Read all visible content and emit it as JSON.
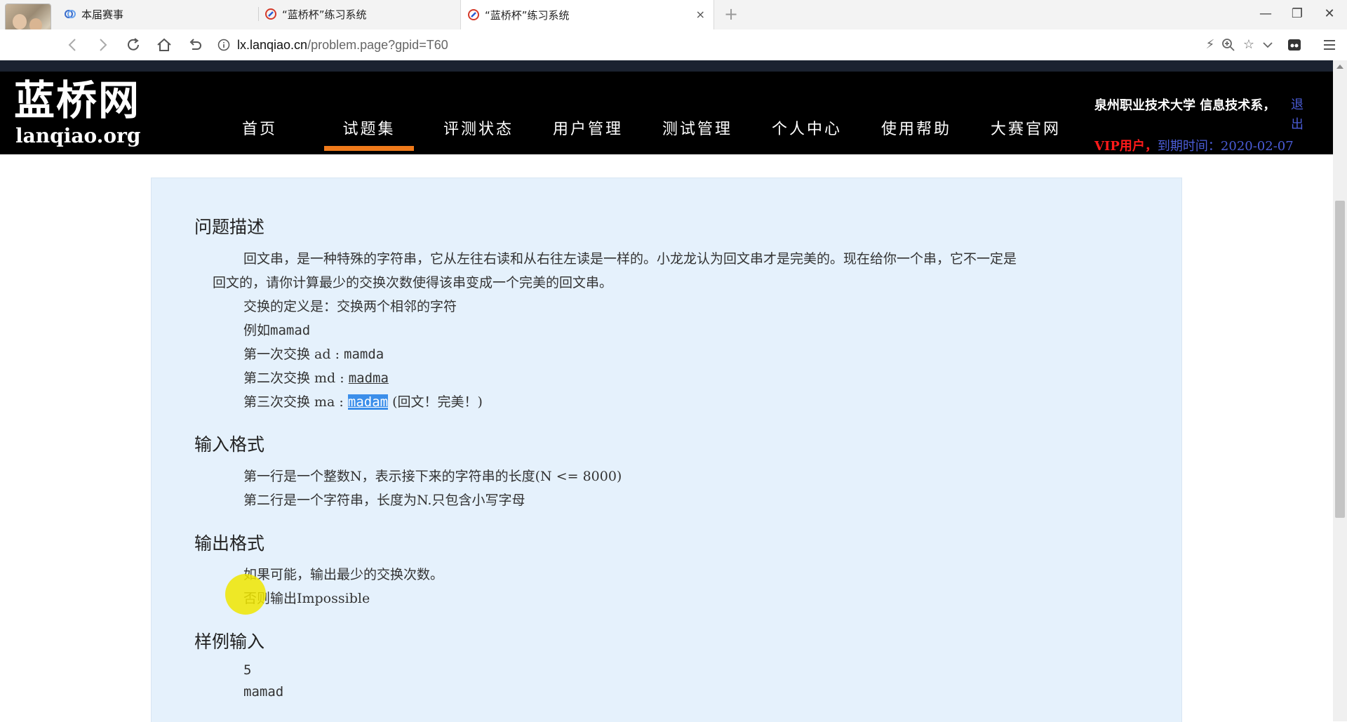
{
  "browser": {
    "tabs": [
      {
        "title": "本届赛事",
        "active": false
      },
      {
        "title": "“蓝桥杯”练习系统",
        "active": false
      },
      {
        "title": "“蓝桥杯”练习系统",
        "active": true
      }
    ],
    "new_tab_label": "+",
    "close_tab_label": "×",
    "window_controls": {
      "minimize": "—",
      "restore": "❐",
      "close": "✕"
    },
    "url_host": "lx.lanqiao.cn",
    "url_path": "/problem.page?gpid=T60",
    "icons": [
      "back-icon",
      "forward-icon",
      "reload-icon",
      "home-icon",
      "undo-icon",
      "info-icon",
      "lightning-icon",
      "zoom-icon",
      "star-icon",
      "chevron-down-icon",
      "extension-icon",
      "menu-icon"
    ]
  },
  "site": {
    "logo_cn": "蓝桥网",
    "logo_en": "lanqiao.org",
    "nav": [
      {
        "label": "首页",
        "active": false
      },
      {
        "label": "试题集",
        "active": true
      },
      {
        "label": "评测状态",
        "active": false
      },
      {
        "label": "用户管理",
        "active": false
      },
      {
        "label": "测试管理",
        "active": false
      },
      {
        "label": "个人中心",
        "active": false
      },
      {
        "label": "使用帮助",
        "active": false
      },
      {
        "label": "大赛官网",
        "active": false
      }
    ],
    "user_school": "泉州职业技术大学 信息技术系，",
    "logout": "退出",
    "vip_label": "VIP用户，",
    "expiry_label": "到期时间：2020-02-07",
    "accent_color": "#f07a1a"
  },
  "problem": {
    "description_title": "问题描述",
    "description_line1": "回文串，是一种特殊的字符串，它从左往右读和从右往左读是一样的。小龙龙认为回文串才是完美的。现在给你一个串，它不一定是",
    "description_line2": "回文的，请你计算最少的交换次数使得该串变成一个完美的回文串。",
    "swap_definition": "交换的定义是：交换两个相邻的字符",
    "example_prefix": "例如",
    "example_word": "mamad",
    "step1_prefix": "第一次交换 ad : ",
    "step1_result": "mamda",
    "step2_prefix": "第二次交换 md : ",
    "step2_result": "madma",
    "step3_prefix": "第三次交换 ma : ",
    "step3_result": "madam",
    "step3_suffix": " (回文！完美！)",
    "input_title": "输入格式",
    "input_line1": "第一行是一个整数N，表示接下来的字符串的长度(N <= 8000)",
    "input_line2": "第二行是一个字符串，长度为N.只包含小写字母",
    "output_title": "输出格式",
    "output_line1": "如果可能，输出最少的交换次数。",
    "output_line2": "否则输出Impossible",
    "sample_input_title": "样例输入",
    "sample_input_line1": "5",
    "sample_input_line2": "mamad"
  }
}
